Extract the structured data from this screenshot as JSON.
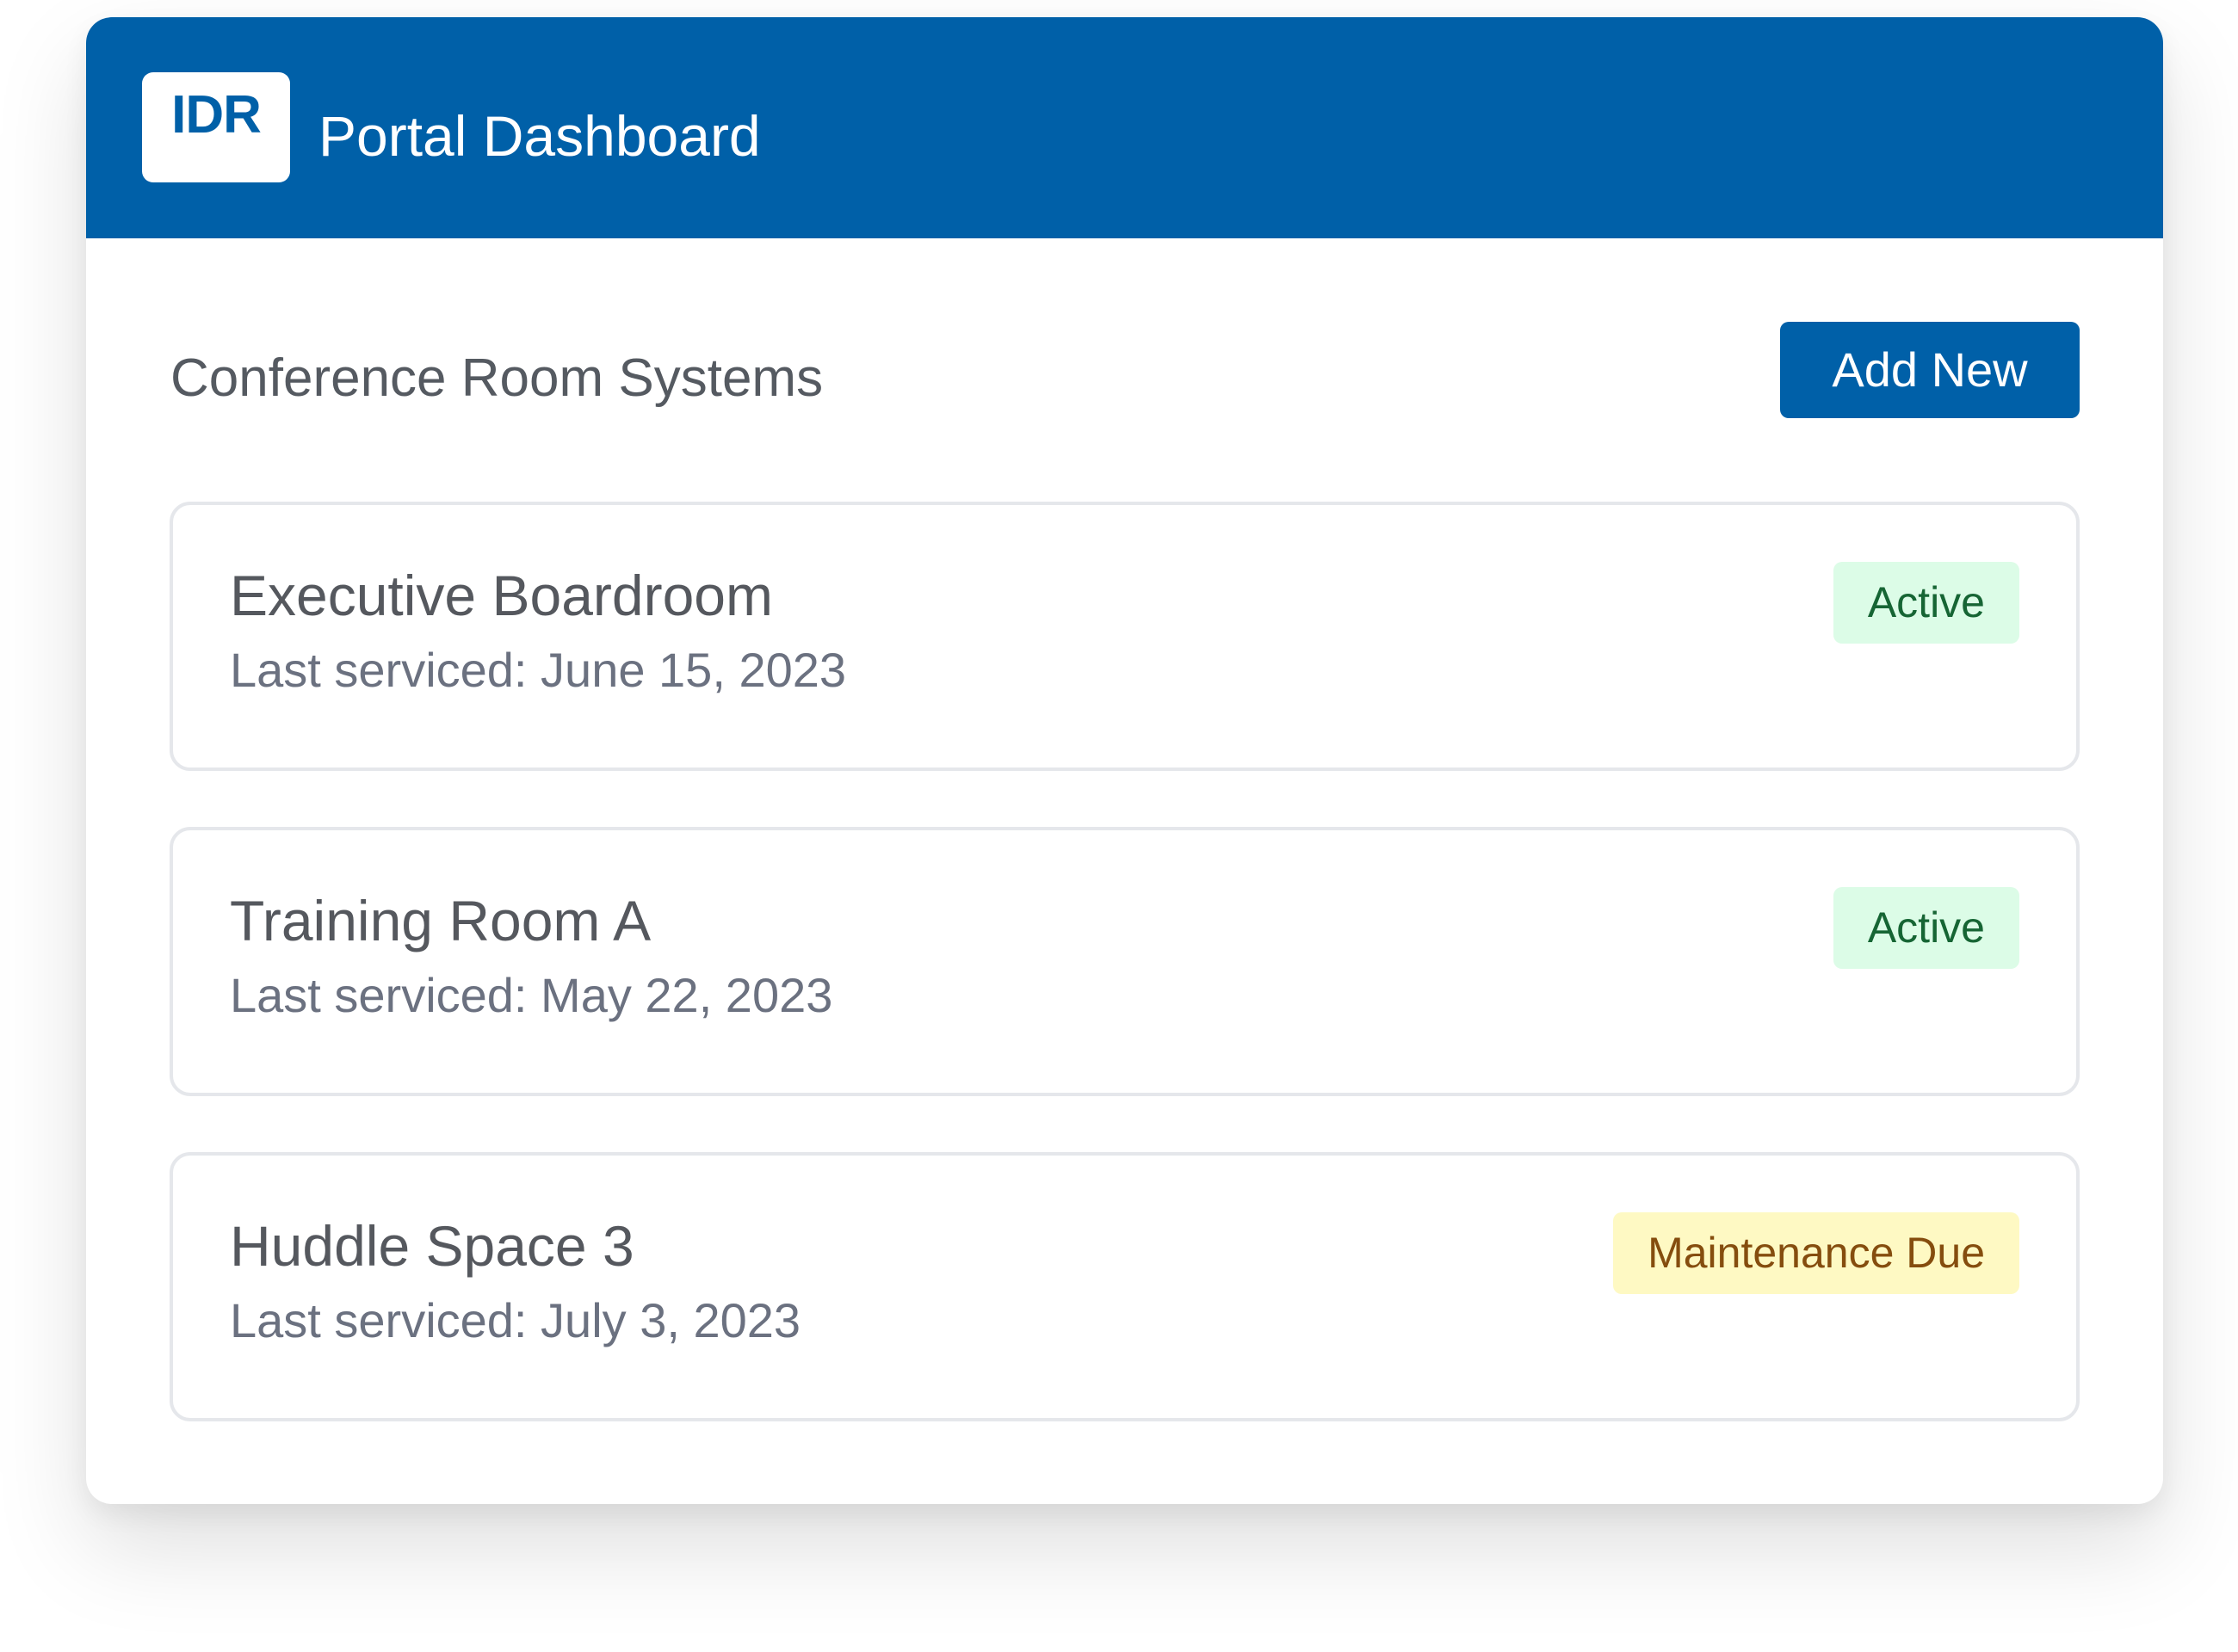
{
  "header": {
    "logo_text": "IDR",
    "title": "Portal Dashboard"
  },
  "main": {
    "section_title": "Conference Room Systems",
    "add_button_label": "Add New",
    "rooms": [
      {
        "name": "Executive Boardroom",
        "last_serviced": "Last serviced: June 15, 2023",
        "status": "Active",
        "status_bg": "#dcfce7",
        "status_fg": "#166534"
      },
      {
        "name": "Training Room A",
        "last_serviced": "Last serviced: May 22, 2023",
        "status": "Active",
        "status_bg": "#dcfce7",
        "status_fg": "#166534"
      },
      {
        "name": "Huddle Space 3",
        "last_serviced": "Last serviced: July 3, 2023",
        "status": "Maintenance Due",
        "status_bg": "#fef9c3",
        "status_fg": "#854d0e"
      }
    ]
  },
  "colors": {
    "brand": "#0060a8"
  }
}
